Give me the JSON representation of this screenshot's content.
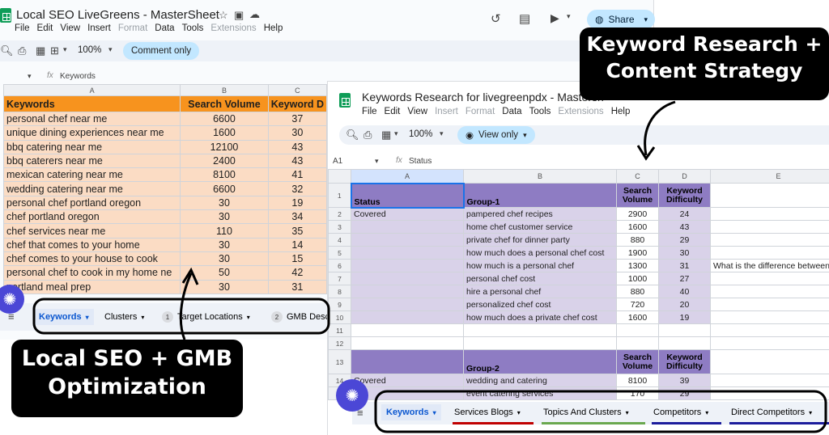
{
  "back_sheet": {
    "title": "Local SEO LiveGreens - MasterSheet",
    "menu": [
      "File",
      "Edit",
      "View",
      "Insert",
      "Format",
      "Data",
      "Tools",
      "Extensions",
      "Help"
    ],
    "zoom": "100%",
    "mode_pill": "Comment only",
    "share_label": "Share",
    "formula_content": "Keywords",
    "columns": [
      "A",
      "B",
      "C"
    ],
    "headers": [
      "Keywords",
      "Search Volume",
      "Keyword D"
    ],
    "rows": [
      [
        "personal chef near me",
        "6600",
        "37"
      ],
      [
        "unique dining experiences near me",
        "1600",
        "30"
      ],
      [
        "bbq catering near me",
        "12100",
        "43"
      ],
      [
        "bbq caterers near me",
        "2400",
        "43"
      ],
      [
        "mexican catering near me",
        "8100",
        "41"
      ],
      [
        "wedding catering near me",
        "6600",
        "32"
      ],
      [
        "personal chef portland oregon",
        "30",
        "19"
      ],
      [
        "chef portland oregon",
        "30",
        "34"
      ],
      [
        "chef services near me",
        "110",
        "35"
      ],
      [
        "chef that comes to your home",
        "30",
        "14"
      ],
      [
        "chef comes to your house to cook",
        "30",
        "15"
      ],
      [
        "personal chef to cook in my home ne",
        "50",
        "42"
      ],
      [
        "portland meal prep",
        "30",
        "31"
      ]
    ],
    "tabs": [
      {
        "label": "Keywords",
        "badge": ""
      },
      {
        "label": "Clusters",
        "badge": ""
      },
      {
        "label": "Target Locations",
        "badge": "1"
      },
      {
        "label": "GMB Desc",
        "badge": "2"
      }
    ]
  },
  "front_sheet": {
    "title": "Keywords Research for livegreenpdx - Mastersh",
    "menu": [
      "File",
      "Edit",
      "View",
      "Insert",
      "Format",
      "Data",
      "Tools",
      "Extensions",
      "Help"
    ],
    "zoom": "100%",
    "mode_pill": "View only",
    "cell_ref": "A1",
    "formula_content": "Status",
    "columns": [
      "A",
      "B",
      "C",
      "D",
      "E"
    ],
    "group1_header": {
      "status": "Status",
      "group": "Group-1",
      "volume": "Search Volume",
      "difficulty": "Keyword Difficulty"
    },
    "group1_rows": [
      {
        "n": "2",
        "status": "Covered",
        "kw": "pampered chef recipes",
        "vol": "2900",
        "kd": "24",
        "note": ""
      },
      {
        "n": "3",
        "status": "",
        "kw": "home chef customer service",
        "vol": "1600",
        "kd": "43",
        "note": ""
      },
      {
        "n": "4",
        "status": "",
        "kw": "private chef for dinner party",
        "vol": "880",
        "kd": "29",
        "note": ""
      },
      {
        "n": "5",
        "status": "",
        "kw": "how much does a personal chef cost",
        "vol": "1900",
        "kd": "30",
        "note": ""
      },
      {
        "n": "6",
        "status": "",
        "kw": "how much is a personal chef",
        "vol": "1300",
        "kd": "31",
        "note": "What is the difference between a"
      },
      {
        "n": "7",
        "status": "",
        "kw": "personal chef cost",
        "vol": "1000",
        "kd": "27",
        "note": ""
      },
      {
        "n": "8",
        "status": "",
        "kw": "hire a personal chef",
        "vol": "880",
        "kd": "40",
        "note": ""
      },
      {
        "n": "9",
        "status": "",
        "kw": "personalized chef cost",
        "vol": "720",
        "kd": "20",
        "note": ""
      },
      {
        "n": "10",
        "status": "",
        "kw": "how much does a private chef cost",
        "vol": "1600",
        "kd": "19",
        "note": ""
      }
    ],
    "empty_rows": [
      "11",
      "12"
    ],
    "group2_header": {
      "n": "13",
      "status": "",
      "group": "Group-2",
      "volume": "Search Volume",
      "difficulty": "Keyword Difficulty"
    },
    "group2_rows": [
      {
        "n": "14",
        "status": "Covered",
        "kw": "wedding and catering",
        "vol": "8100",
        "kd": "39"
      },
      {
        "n": "15",
        "status": "",
        "kw": "event catering services",
        "vol": "170",
        "kd": "29"
      }
    ],
    "tabs": [
      "Keywords",
      "Services Blogs",
      "Topics And Clusters",
      "Competitors",
      "Direct Competitors"
    ]
  },
  "annotations": {
    "top_right": "Keyword Research + Content Strategy",
    "bottom_left": "Local SEO + GMB Optimization"
  },
  "colors": {
    "orange_header": "#f7931e",
    "peach_rows": "#fbdcc4",
    "purple_header": "#8e7cc3",
    "lavender_rows": "#d9d2e9",
    "share_pill": "#c2e7ff",
    "fab": "#4b47d6"
  }
}
